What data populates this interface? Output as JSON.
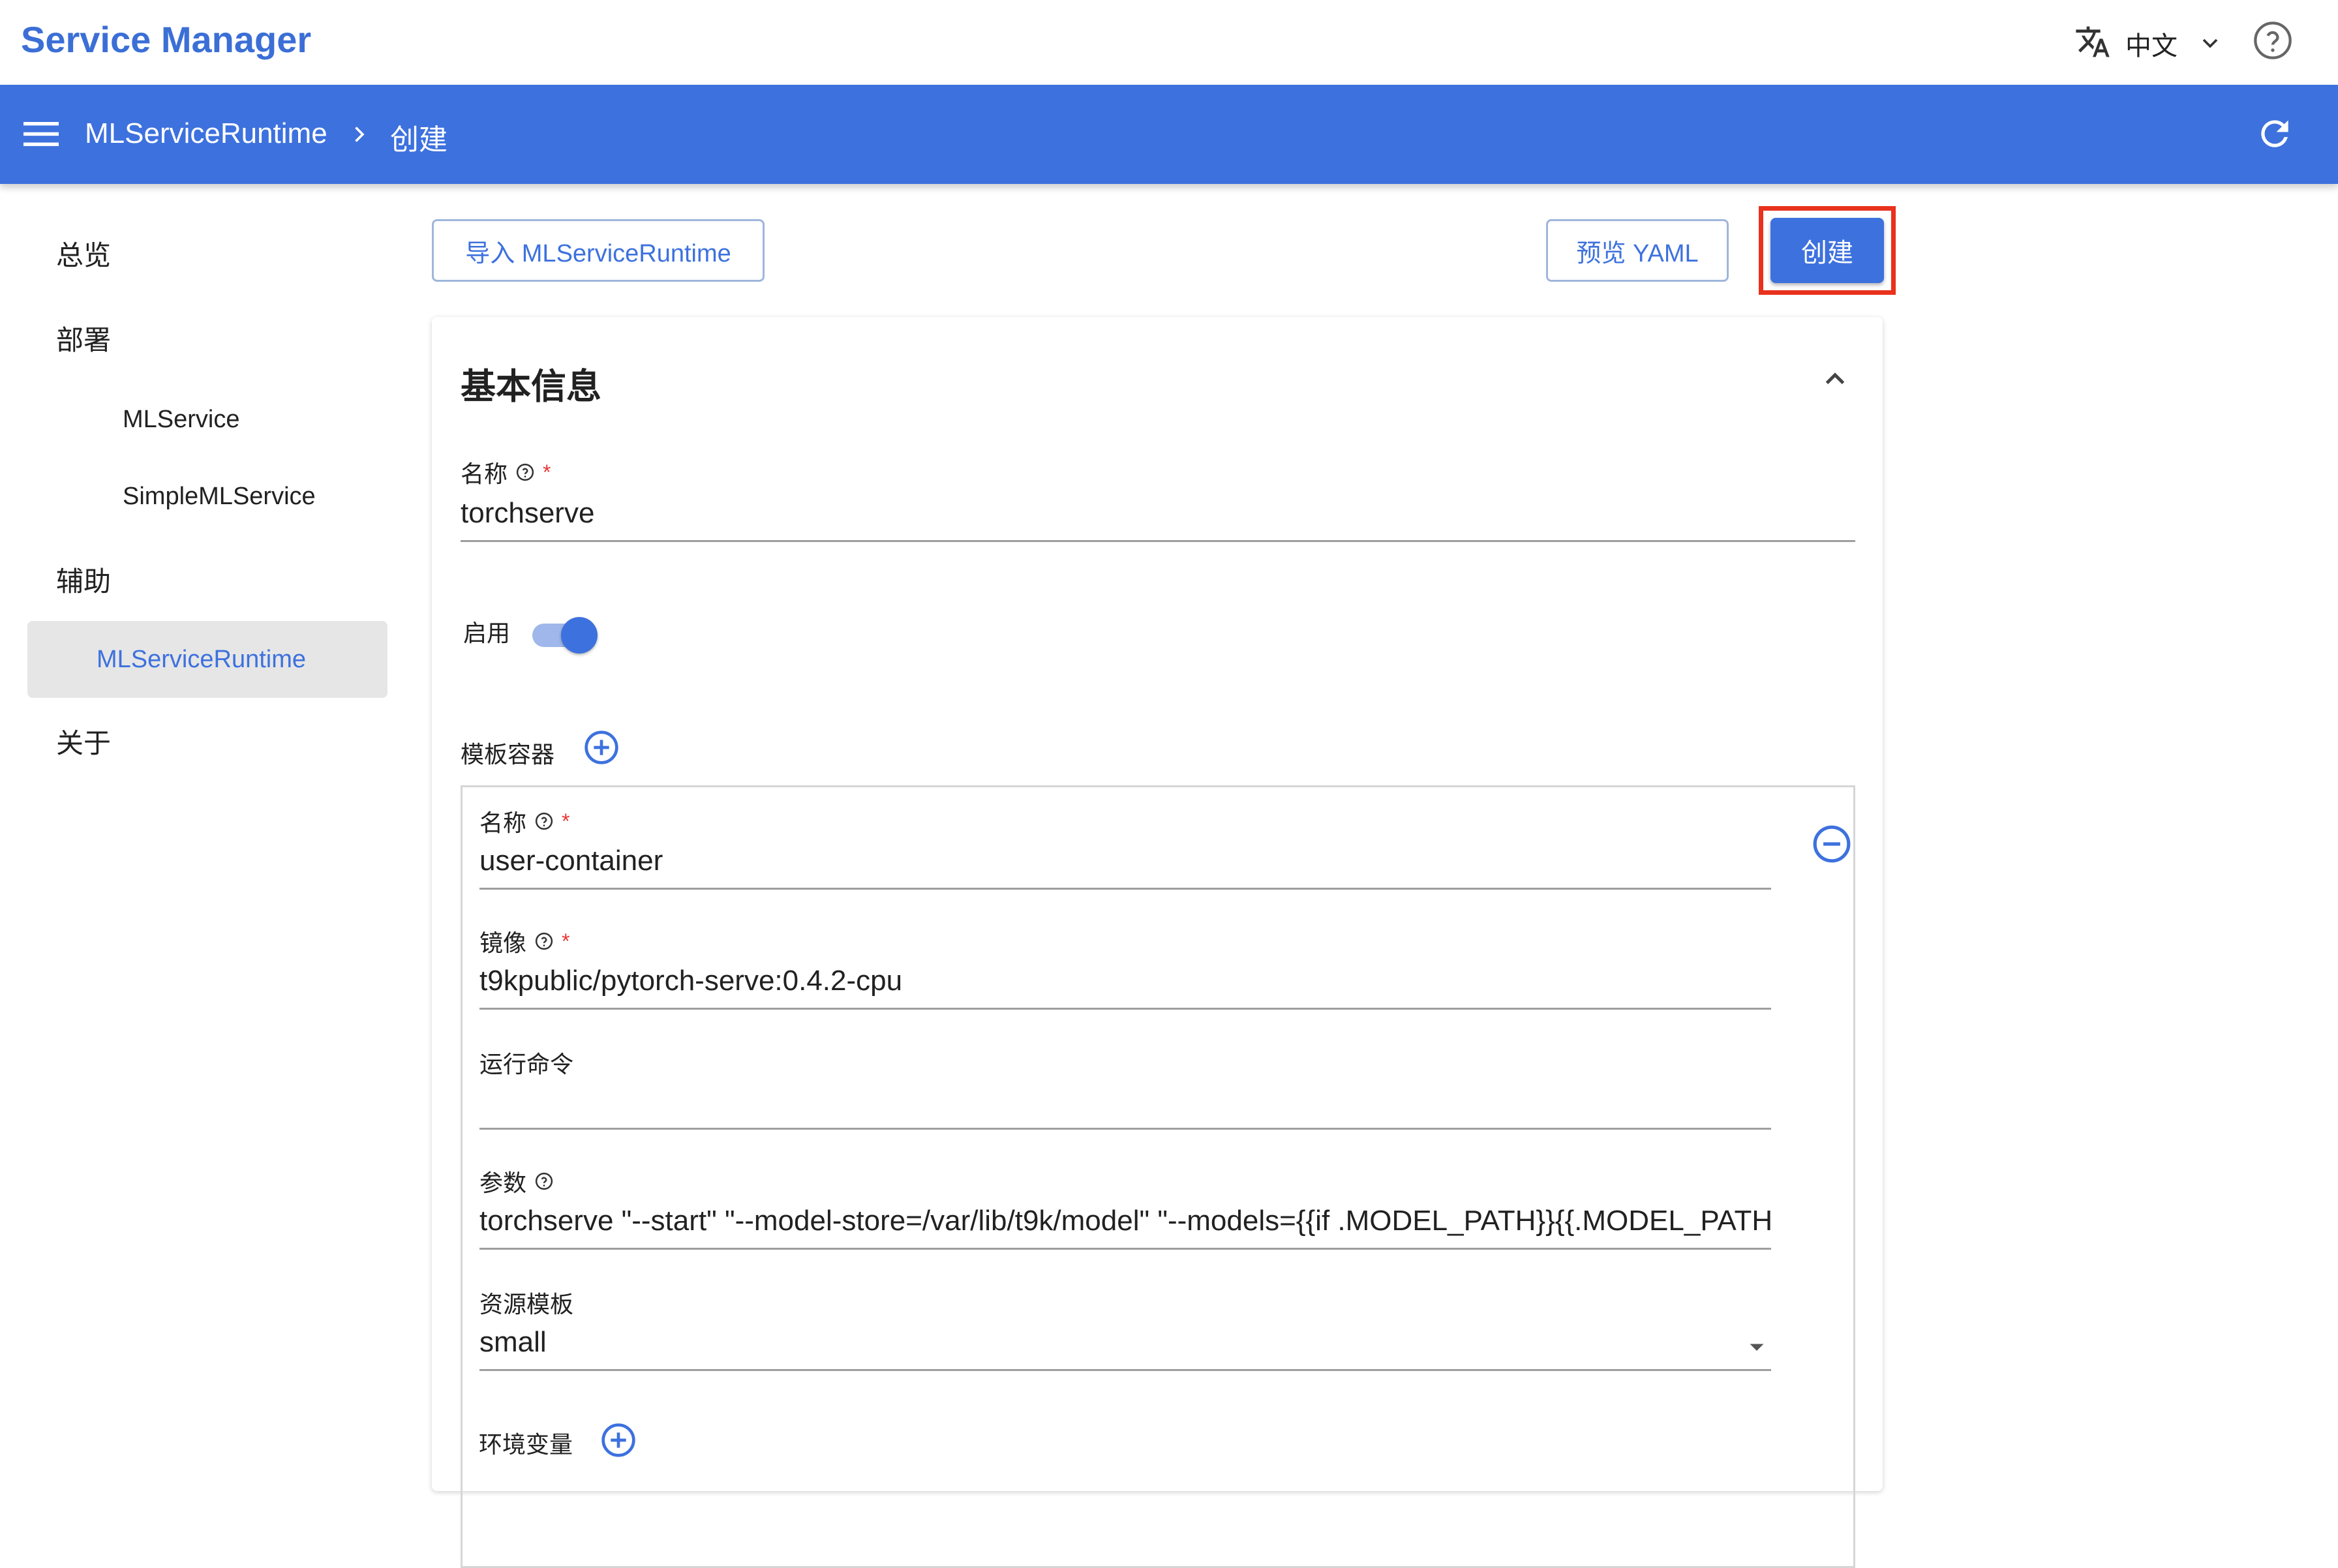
{
  "header": {
    "app_title": "Service Manager",
    "language": "中文"
  },
  "appbar": {
    "breadcrumb": [
      "MLServiceRuntime",
      "创建"
    ]
  },
  "sidebar": {
    "items": [
      {
        "label": "总览"
      },
      {
        "label": "部署"
      },
      {
        "label": "MLService"
      },
      {
        "label": "SimpleMLService"
      },
      {
        "label": "辅助"
      },
      {
        "label": "MLServiceRuntime",
        "active": true
      },
      {
        "label": "关于"
      }
    ]
  },
  "toolbar": {
    "import_label": "导入 MLServiceRuntime",
    "preview_label": "预览 YAML",
    "create_label": "创建"
  },
  "form": {
    "section_title": "基本信息",
    "name_label": "名称",
    "name_value": "torchserve",
    "enable_label": "启用",
    "enabled": true,
    "template_label": "模板容器",
    "container": {
      "name_label": "名称",
      "name_value": "user-container",
      "image_label": "镜像",
      "image_value": "t9kpublic/pytorch-serve:0.4.2-cpu",
      "command_label": "运行命令",
      "command_value": "",
      "args_label": "参数",
      "args_value": "torchserve \"--start\" \"--model-store=/var/lib/t9k/model\" \"--models={{if .MODEL_PATH}}{{.MODEL_PATH}}",
      "resource_label": "资源模板",
      "resource_value": "small",
      "env_label": "环境变量"
    }
  },
  "colors": {
    "primary": "#3d71de",
    "highlight": "#e8321d",
    "required": "#e53935"
  }
}
